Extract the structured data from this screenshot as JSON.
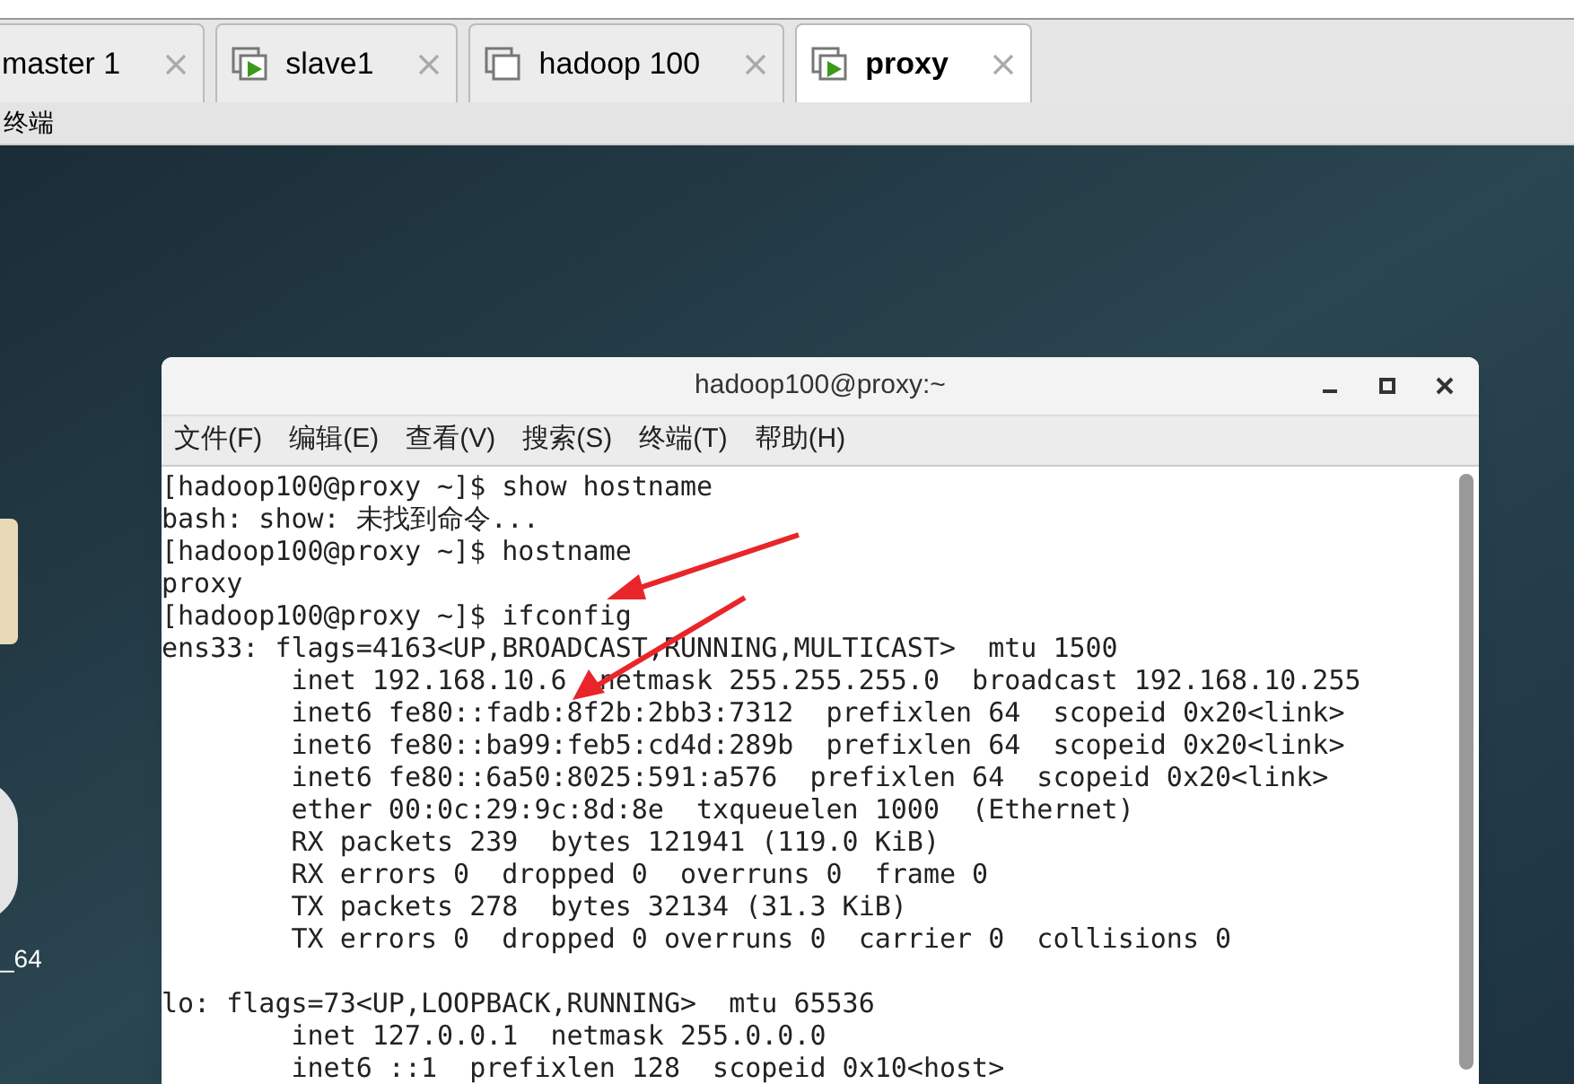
{
  "tabs": [
    {
      "label": "master 1",
      "selected": false
    },
    {
      "label": "slave1",
      "running": true,
      "selected": false
    },
    {
      "label": "hadoop 100",
      "running": false,
      "selected": false
    },
    {
      "label": "proxy",
      "running": true,
      "selected": true
    }
  ],
  "toolbar": {
    "label": "终端"
  },
  "desktop_icons": [
    {
      "label": "_64"
    }
  ],
  "terminal": {
    "title": "hadoop100@proxy:~",
    "menu": [
      "文件(F)",
      "编辑(E)",
      "查看(V)",
      "搜索(S)",
      "终端(T)",
      "帮助(H)"
    ],
    "blocks": [
      [
        "[hadoop100@proxy ~]$ show hostname",
        "bash: show: 未找到命令...",
        "[hadoop100@proxy ~]$ hostname",
        "proxy",
        "[hadoop100@proxy ~]$ ifconfig",
        "ens33: flags=4163<UP,BROADCAST,RUNNING,MULTICAST>  mtu 1500",
        "        inet 192.168.10.6  netmask 255.255.255.0  broadcast 192.168.10.255",
        "        inet6 fe80::fadb:8f2b:2bb3:7312  prefixlen 64  scopeid 0x20<link>",
        "        inet6 fe80::ba99:feb5:cd4d:289b  prefixlen 64  scopeid 0x20<link>",
        "        inet6 fe80::6a50:8025:591:a576  prefixlen 64  scopeid 0x20<link>",
        "        ether 00:0c:29:9c:8d:8e  txqueuelen 1000  (Ethernet)",
        "        RX packets 239  bytes 121941 (119.0 KiB)",
        "        RX errors 0  dropped 0  overruns 0  frame 0",
        "        TX packets 278  bytes 32134 (31.3 KiB)",
        "        TX errors 0  dropped 0 overruns 0  carrier 0  collisions 0"
      ],
      [
        "lo: flags=73<UP,LOOPBACK,RUNNING>  mtu 65536",
        "        inet 127.0.0.1  netmask 255.0.0.0",
        "        inet6 ::1  prefixlen 128  scopeid 0x10<host>"
      ]
    ]
  }
}
